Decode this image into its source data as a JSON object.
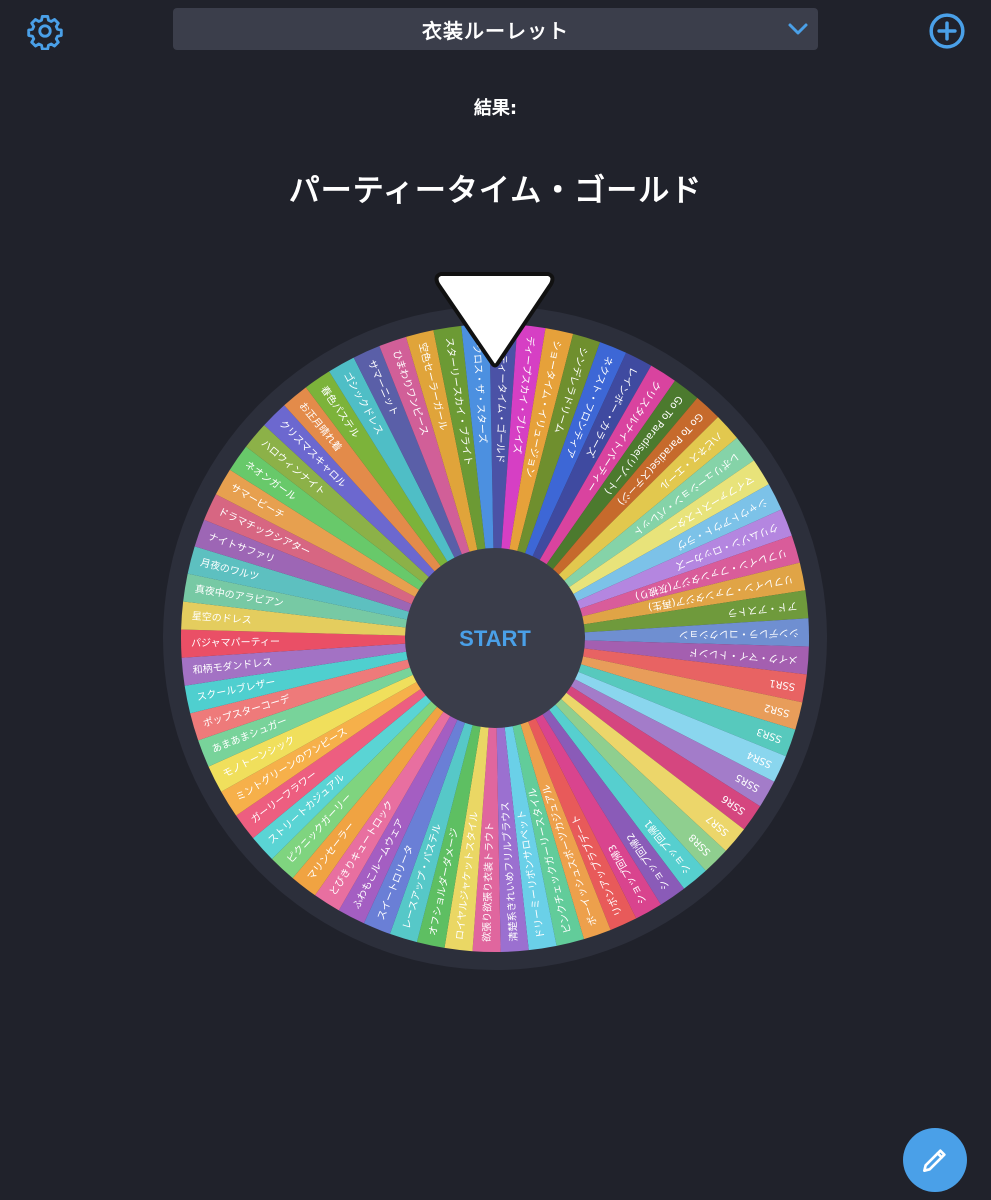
{
  "header": {
    "roulette_title": "衣装ルーレット",
    "settings_icon": "gear-icon",
    "dropdown_icon": "chevron-down-icon",
    "add_icon": "plus-circle-icon"
  },
  "result": {
    "label": "結果:",
    "value": "パーティータイム・ゴールド"
  },
  "wheel": {
    "start_label": "START",
    "pointer_icon": "pointer-triangle-icon",
    "segments": [
      {
        "label": "パーティータイム・ゴールド",
        "color": "#4b52a6"
      },
      {
        "label": "ディープスカイ・ブレイズ",
        "color": "#d63fc4"
      },
      {
        "label": "ショータイム・イリュージョン",
        "color": "#e6a13a"
      },
      {
        "label": "シンデレラドリーム",
        "color": "#6f8f2e"
      },
      {
        "label": "ネクスト・フロンティア",
        "color": "#3d67d6"
      },
      {
        "label": "レインボー・カラーズ",
        "color": "#3f4aa0"
      },
      {
        "label": "クリスタルナイトパーティー",
        "color": "#d9439f"
      },
      {
        "label": "Go To Paradise(リゾート)",
        "color": "#4c7a2e"
      },
      {
        "label": "Go To Paradise(ステージ)",
        "color": "#c66a2c"
      },
      {
        "label": "ハピネス・エール",
        "color": "#e2c84e"
      },
      {
        "label": "レボリューション・パレット",
        "color": "#85d3a8"
      },
      {
        "label": "マイファーストスター",
        "color": "#e8e37a"
      },
      {
        "label": "シャウトアウト・ラヴ",
        "color": "#7cc2e8"
      },
      {
        "label": "クリムゾン・ロッカーズ",
        "color": "#b486e0"
      },
      {
        "label": "リフレイン・ファンタジア(灰被り)",
        "color": "#d95c9a"
      },
      {
        "label": "リフレイン・ファンタジア(再生)",
        "color": "#e0a446"
      },
      {
        "label": "アド・アストラ",
        "color": "#6f9a3c"
      },
      {
        "label": "シンデレラ・コレクション",
        "color": "#6f8fd1"
      },
      {
        "label": "メイク・マイ・トレンド",
        "color": "#a45fb0"
      },
      {
        "label": "SSR1",
        "color": "#e86363"
      },
      {
        "label": "SSR2",
        "color": "#e89d5a"
      },
      {
        "label": "SSR3",
        "color": "#57c9bd"
      },
      {
        "label": "SSR4",
        "color": "#8ad6ee"
      },
      {
        "label": "SSR5",
        "color": "#a37cc9"
      },
      {
        "label": "SSR6",
        "color": "#d5467f"
      },
      {
        "label": "SSR7",
        "color": "#ecd66a"
      },
      {
        "label": "SSR8",
        "color": "#8fcf8f"
      },
      {
        "label": "ショップ回帰1",
        "color": "#56cfcf"
      },
      {
        "label": "ショップ回帰2",
        "color": "#8a5bb8"
      },
      {
        "label": "ショップ回帰3",
        "color": "#d9448e"
      },
      {
        "label": "リボンアップラブデート",
        "color": "#e85a5a"
      },
      {
        "label": "ボーイッシュスポーツカジュアル",
        "color": "#eda04c"
      },
      {
        "label": "ピンクチェックガーリースタイル",
        "color": "#62cc9a"
      },
      {
        "label": "ドリーミーリボンサロペット",
        "color": "#6ad0e8"
      },
      {
        "label": "清楚系きれいめフリルブラウス",
        "color": "#9b70d0"
      },
      {
        "label": "欲張り欲張り衣装トラウト",
        "color": "#e0669e"
      },
      {
        "label": "ロイヤルジャケットスタイル",
        "color": "#ead764"
      },
      {
        "label": "オフショルダーダメージ",
        "color": "#5ebf62"
      },
      {
        "label": "レースアップ・パステル",
        "color": "#56c8c8"
      },
      {
        "label": "スイートロリータ",
        "color": "#6a7fd6"
      },
      {
        "label": "ふわもこルームウェア",
        "color": "#a45ec2"
      },
      {
        "label": "とびきりキュートロック",
        "color": "#e86fa0"
      },
      {
        "label": "マリンセーラー",
        "color": "#f0a342"
      },
      {
        "label": "ピクニックガーリー",
        "color": "#7fd47f"
      },
      {
        "label": "ストリートカジュアル",
        "color": "#5ad4d4"
      },
      {
        "label": "ガーリーフラワー",
        "color": "#ed5e80"
      },
      {
        "label": "ミントグリーンのワンピース",
        "color": "#f6b04a"
      },
      {
        "label": "モノトーンシック",
        "color": "#f0df5c"
      },
      {
        "label": "あまあまシュガー",
        "color": "#78d39a"
      },
      {
        "label": "ポップスターコーデ",
        "color": "#ee7a7a"
      },
      {
        "label": "スクールブレザー",
        "color": "#4fcfcf"
      },
      {
        "label": "和柄モダンドレス",
        "color": "#a372c4"
      },
      {
        "label": "パジャマパーティー",
        "color": "#ea4f66"
      },
      {
        "label": "星空のドレス",
        "color": "#e4cd5e"
      },
      {
        "label": "真夜中のアラビアン",
        "color": "#77c9a4"
      },
      {
        "label": "月夜のワルツ",
        "color": "#5dc0c0"
      },
      {
        "label": "ナイトサファリ",
        "color": "#9d66b5"
      },
      {
        "label": "ドラマチックシアター",
        "color": "#d76682"
      },
      {
        "label": "サマービーチ",
        "color": "#e7a04f"
      },
      {
        "label": "ネオンガール",
        "color": "#68c96a"
      },
      {
        "label": "ハロウィンナイト",
        "color": "#8cb148"
      },
      {
        "label": "クリスマスキャロル",
        "color": "#6c68cf"
      },
      {
        "label": "お正月晴れ着",
        "color": "#e38b4a"
      },
      {
        "label": "春色パステル",
        "color": "#7cb33a"
      },
      {
        "label": "ゴシックドレス",
        "color": "#4fbec6"
      },
      {
        "label": "サマーニット",
        "color": "#5a5fa8"
      },
      {
        "label": "ひまわりワンピース",
        "color": "#d15f98"
      },
      {
        "label": "空色セーラーガール",
        "color": "#e0a43a"
      },
      {
        "label": "スターリースカイ・ブライト",
        "color": "#6c9a34"
      },
      {
        "label": "アクロス・ザ・スターズ",
        "color": "#4c90e0"
      }
    ]
  },
  "fab": {
    "edit_icon": "pencil-icon"
  }
}
